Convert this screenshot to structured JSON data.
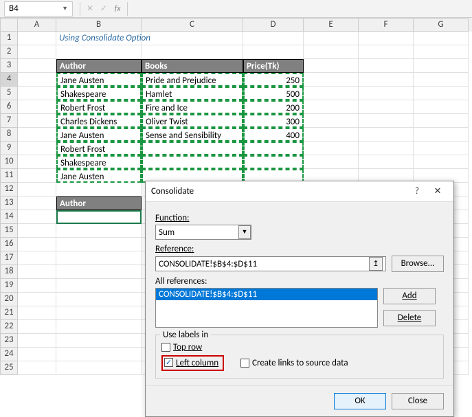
{
  "namebox": "B4",
  "title": "Using Consolidate Option",
  "columns": [
    "A",
    "B",
    "C",
    "D",
    "E",
    "F",
    "G"
  ],
  "rows": [
    "1",
    "2",
    "3",
    "4",
    "5",
    "6",
    "7",
    "8",
    "9",
    "10",
    "11",
    "12",
    "13",
    "14",
    "15",
    "16",
    "17",
    "18",
    "19",
    "20",
    "21",
    "22",
    "23",
    "24",
    "25"
  ],
  "headers": {
    "c1": "Author",
    "c2": "Books",
    "c3": "Price(Tk)"
  },
  "data": [
    {
      "author": "Jane Austen",
      "book": "Pride and Prejudice",
      "price": "250"
    },
    {
      "author": "Shakespeare",
      "book": "Hamlet",
      "price": "500"
    },
    {
      "author": "Robert Frost",
      "book": "Fire and Ice",
      "price": "200"
    },
    {
      "author": "Charles Dickens",
      "book": "Oliver Twist",
      "price": "300"
    },
    {
      "author": "Jane Austen",
      "book": "Sense and Sensibility",
      "price": "400"
    },
    {
      "author": "Robert Frost",
      "book": "",
      "price": ""
    },
    {
      "author": "Shakespeare",
      "book": "",
      "price": ""
    },
    {
      "author": "Jane Austen",
      "book": "",
      "price": ""
    }
  ],
  "result_header": "Author",
  "dialog": {
    "title": "Consolidate",
    "function_label": "Function:",
    "function_value": "Sum",
    "reference_label": "Reference:",
    "reference_value": "CONSOLIDATE!$B$4:$D$11",
    "allrefs_label": "All references:",
    "allrefs_item": "CONSOLIDATE!$B$4:$D$11",
    "browse": "Browse...",
    "add": "Add",
    "delete": "Delete",
    "uselabels": "Use labels in",
    "toprow": "Top row",
    "leftcol": "Left column",
    "createlinks": "Create links to source data",
    "ok": "OK",
    "close": "Close"
  }
}
